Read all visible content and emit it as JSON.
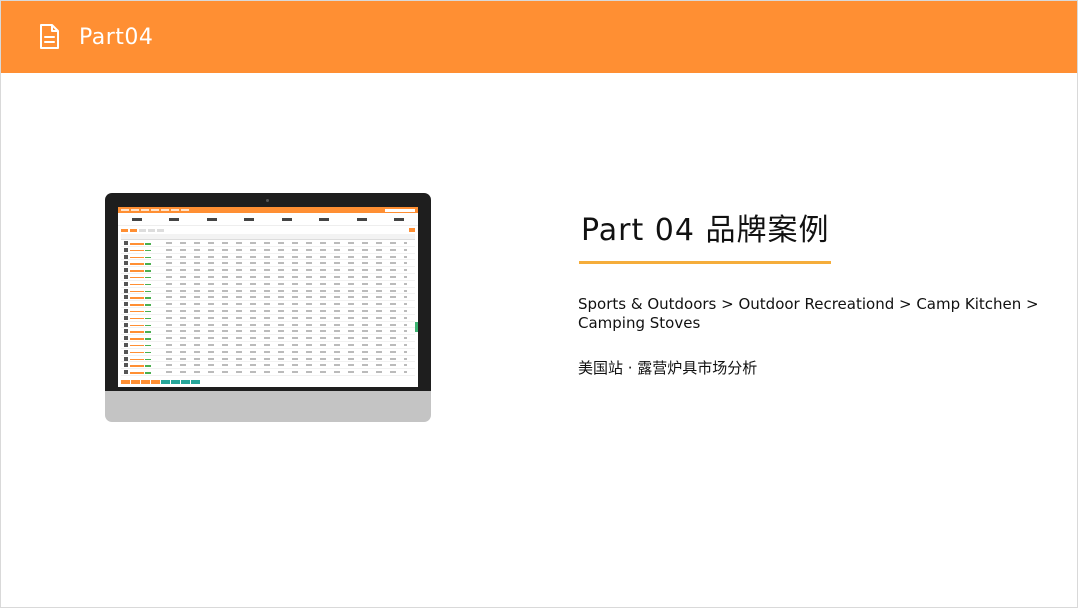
{
  "header": {
    "title": "Part04",
    "icon": "document-icon",
    "background": "#ff8f33"
  },
  "section": {
    "title": "Part 04 品牌案例",
    "underline_color": "#f5ad3b",
    "category_path": "Sports & Outdoors > Outdoor Recreationd > Camp Kitchen > Camping Stoves",
    "subtitle": "美国站 · 露营炉具市场分析"
  }
}
